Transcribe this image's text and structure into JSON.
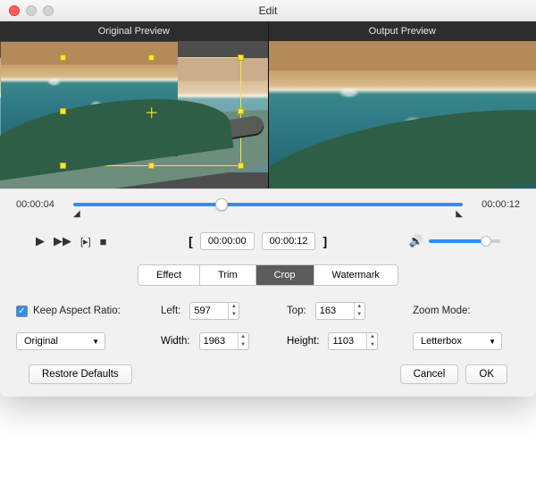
{
  "window": {
    "title": "Edit"
  },
  "headers": {
    "original": "Original Preview",
    "output": "Output Preview"
  },
  "timeline": {
    "start": "00:00:04",
    "end": "00:00:12",
    "playhead_pct": 38
  },
  "transport": {
    "in_tc": "00:00:00",
    "out_tc": "00:00:12",
    "volume_pct": 80
  },
  "tabs": {
    "items": [
      "Effect",
      "Trim",
      "Crop",
      "Watermark"
    ],
    "active": 2
  },
  "crop": {
    "keep_ratio_label": "Keep Aspect Ratio:",
    "keep_ratio_checked": true,
    "left_label": "Left:",
    "left": "597",
    "top_label": "Top:",
    "top": "163",
    "width_label": "Width:",
    "width": "1963",
    "height_label": "Height:",
    "height": "1103",
    "zoom_mode_label": "Zoom Mode:",
    "ratio_select": "Original",
    "zoom_select": "Letterbox"
  },
  "footer": {
    "restore": "Restore Defaults",
    "cancel": "Cancel",
    "ok": "OK"
  }
}
